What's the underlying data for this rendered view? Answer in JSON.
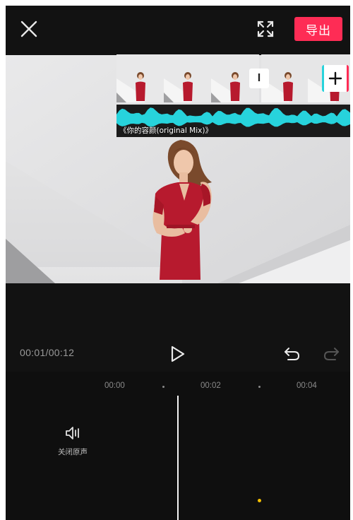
{
  "topbar": {
    "close_icon": "close-icon",
    "fullscreen_icon": "fullscreen-icon",
    "export_label": "导出",
    "accent_color": "#fe2c55"
  },
  "preview": {
    "subject": "woman in red dress against white wall"
  },
  "transport": {
    "time": "00:01/00:12",
    "play_icon": "play-icon",
    "undo_icon": "undo-icon",
    "redo_icon": "redo-icon"
  },
  "timeline": {
    "ruler": [
      "00:00",
      "00:02",
      "00:04"
    ],
    "mute": {
      "icon": "speaker-icon",
      "label": "关闭原声"
    },
    "transition_label": "I",
    "add_icon": "plus-icon",
    "audio": {
      "title": "《你的容颜(original Mix)》",
      "waveform_color": "#27d3dc"
    }
  }
}
